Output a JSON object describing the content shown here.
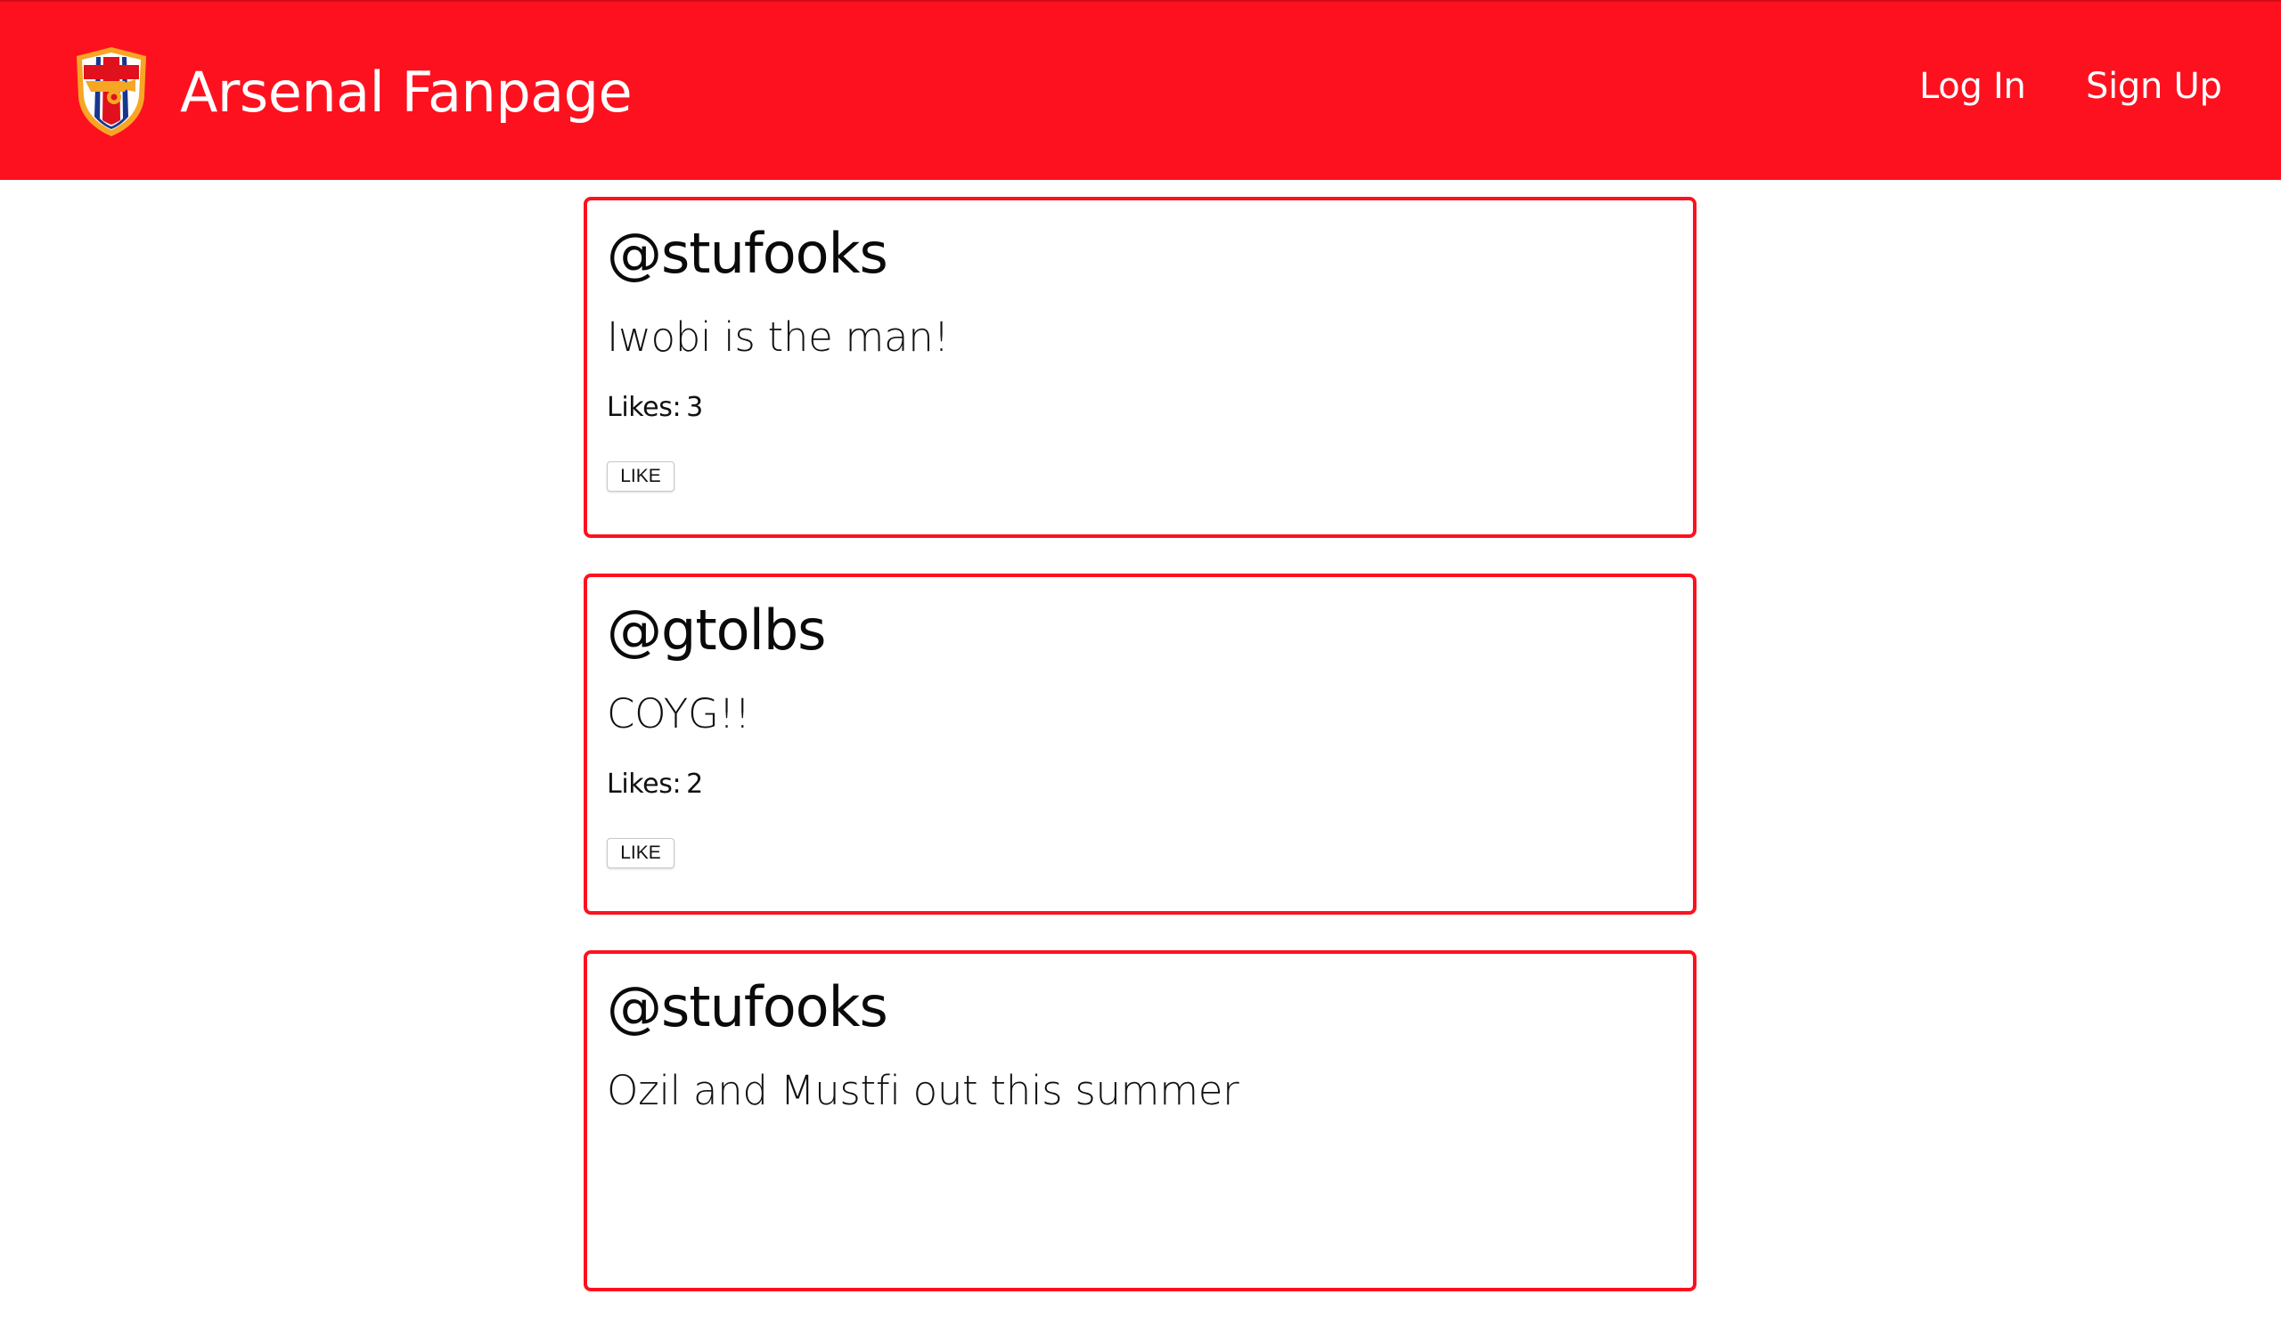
{
  "navbar": {
    "brand": "Arsenal Fanpage",
    "login_label": "Log In",
    "signup_label": "Sign Up",
    "background_color": "#fe111f",
    "logo_icon": "arsenal-crest-icon"
  },
  "feed": {
    "likes_label": "Likes:",
    "like_button_label": "LIKE",
    "card_border_color": "#fe111f",
    "posts": [
      {
        "username": "@stufooks",
        "message": "Iwobi is the man!",
        "likes": "3"
      },
      {
        "username": "@gtolbs",
        "message": "COYG!!",
        "likes": "2"
      },
      {
        "username": "@stufooks",
        "message": "Ozil and Mustfi out this summer"
      }
    ]
  }
}
